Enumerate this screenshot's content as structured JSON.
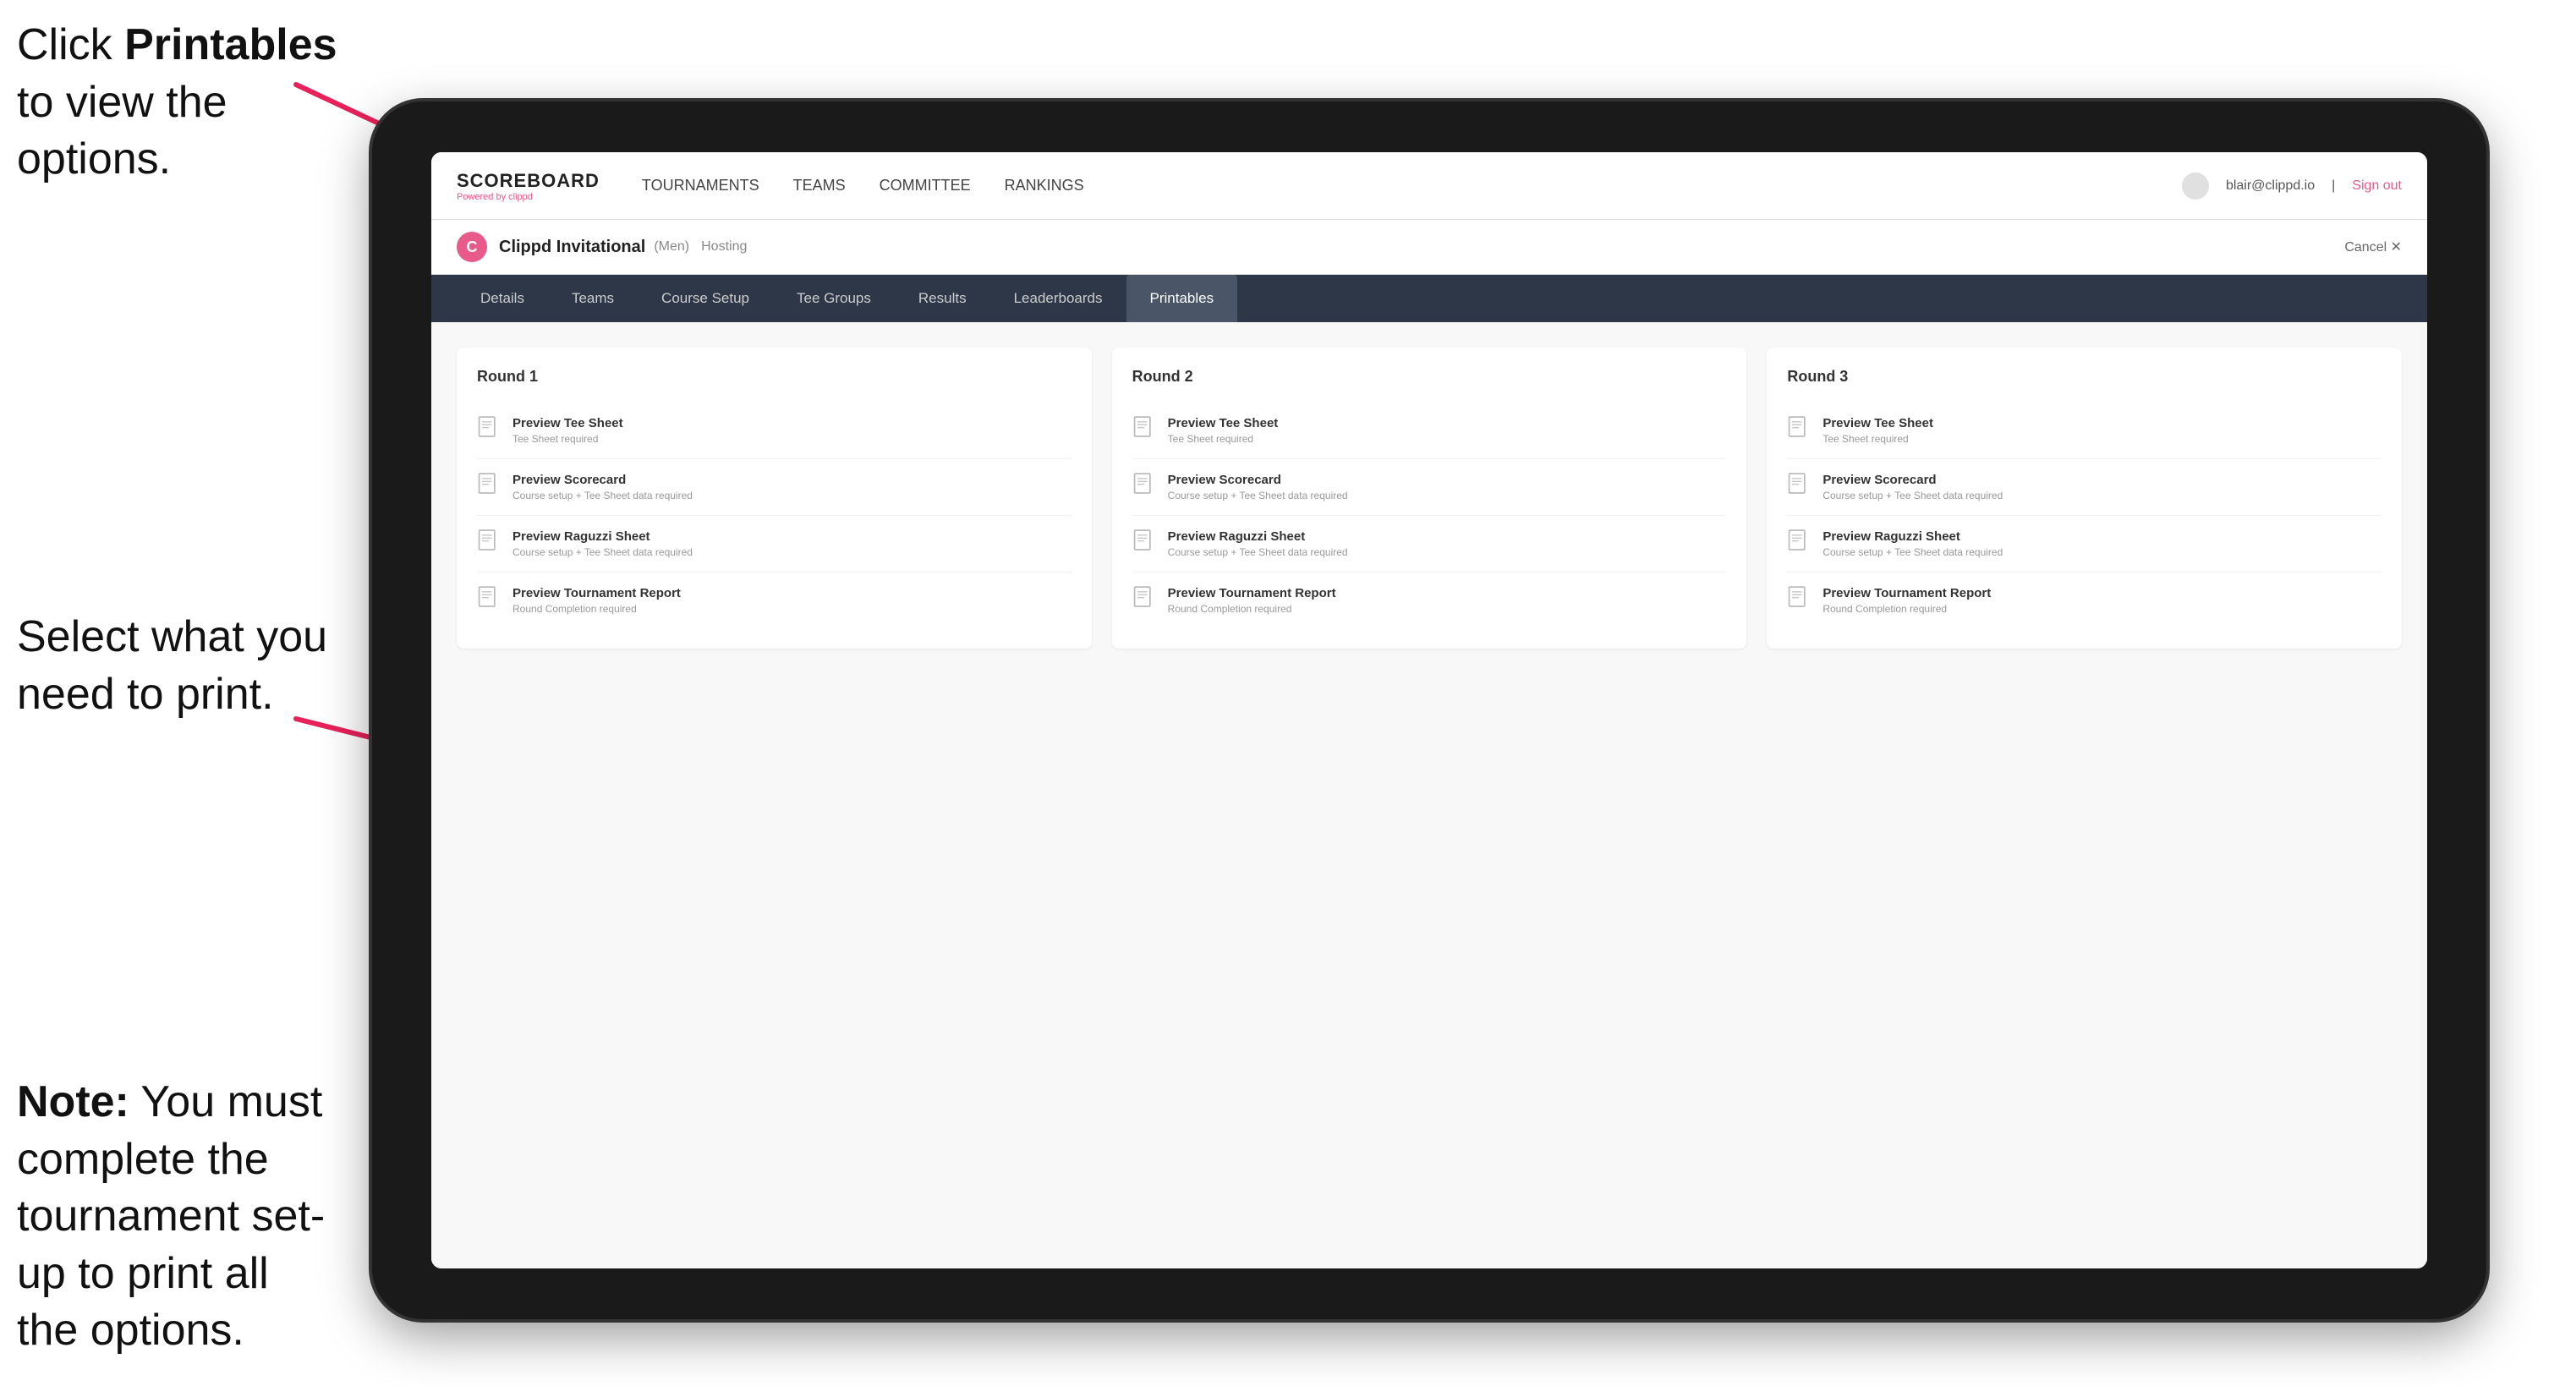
{
  "annotations": {
    "top": {
      "prefix": "Click ",
      "bold": "Printables",
      "suffix": " to view the options."
    },
    "middle": {
      "text": "Select what you need to print."
    },
    "bottom": {
      "bold": "Note:",
      "suffix": " You must complete the tournament set-up to print all the options."
    }
  },
  "topNav": {
    "logo": "SCOREBOARD",
    "logoPowered": "Powered by clippd",
    "links": [
      {
        "label": "TOURNAMENTS",
        "active": false
      },
      {
        "label": "TEAMS",
        "active": false
      },
      {
        "label": "COMMITTEE",
        "active": false
      },
      {
        "label": "RANKINGS",
        "active": false
      }
    ],
    "userEmail": "blair@clippd.io",
    "signOut": "Sign out"
  },
  "tournamentHeader": {
    "logoLetter": "C",
    "name": "Clippd Invitational",
    "type": "(Men)",
    "status": "Hosting",
    "cancelLabel": "Cancel ✕"
  },
  "subNav": {
    "tabs": [
      {
        "label": "Details"
      },
      {
        "label": "Teams"
      },
      {
        "label": "Course Setup"
      },
      {
        "label": "Tee Groups"
      },
      {
        "label": "Results"
      },
      {
        "label": "Leaderboards"
      },
      {
        "label": "Printables",
        "active": true
      }
    ]
  },
  "rounds": [
    {
      "title": "Round 1",
      "items": [
        {
          "label": "Preview Tee Sheet",
          "sublabel": "Tee Sheet required"
        },
        {
          "label": "Preview Scorecard",
          "sublabel": "Course setup + Tee Sheet data required"
        },
        {
          "label": "Preview Raguzzi Sheet",
          "sublabel": "Course setup + Tee Sheet data required"
        },
        {
          "label": "Preview Tournament Report",
          "sublabel": "Round Completion required"
        }
      ]
    },
    {
      "title": "Round 2",
      "items": [
        {
          "label": "Preview Tee Sheet",
          "sublabel": "Tee Sheet required"
        },
        {
          "label": "Preview Scorecard",
          "sublabel": "Course setup + Tee Sheet data required"
        },
        {
          "label": "Preview Raguzzi Sheet",
          "sublabel": "Course setup + Tee Sheet data required"
        },
        {
          "label": "Preview Tournament Report",
          "sublabel": "Round Completion required"
        }
      ]
    },
    {
      "title": "Round 3",
      "items": [
        {
          "label": "Preview Tee Sheet",
          "sublabel": "Tee Sheet required"
        },
        {
          "label": "Preview Scorecard",
          "sublabel": "Course setup + Tee Sheet data required"
        },
        {
          "label": "Preview Raguzzi Sheet",
          "sublabel": "Course setup + Tee Sheet data required"
        },
        {
          "label": "Preview Tournament Report",
          "sublabel": "Round Completion required"
        }
      ]
    }
  ]
}
